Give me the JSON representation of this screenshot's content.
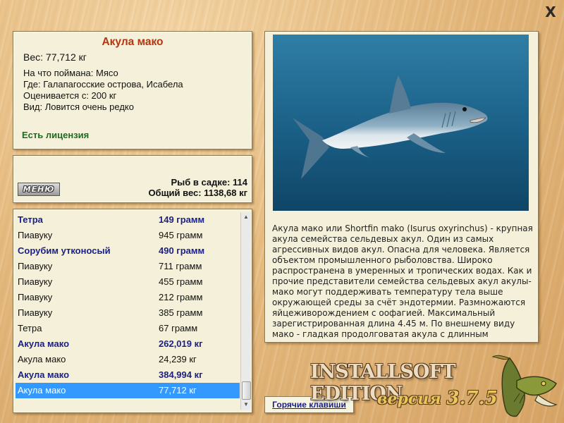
{
  "window": {
    "close_glyph": "X"
  },
  "fish_info": {
    "title": "Акула мако",
    "weight": "Вес: 77,712 кг",
    "bait": "На что поймана: Мясо",
    "location": "Где: Галапагосские острова, Исабела",
    "valued_from": "Оценивается с: 200 кг",
    "rarity": "Вид: Ловится очень редко",
    "license": "Есть лицензия"
  },
  "summary": {
    "menu_logo": "МЕНЮ",
    "fish_count": "Рыб в садке: 114",
    "total_weight": "Общий вес: 1138,68 кг"
  },
  "catch_list": [
    {
      "name": "Тетра",
      "weight": "149 грамм",
      "bold": true,
      "selected": false
    },
    {
      "name": "Пиавуку",
      "weight": "945 грамм",
      "bold": false,
      "selected": false
    },
    {
      "name": "Сорубим утконосый",
      "weight": "490 грамм",
      "bold": true,
      "selected": false
    },
    {
      "name": "Пиавуку",
      "weight": "711 грамм",
      "bold": false,
      "selected": false
    },
    {
      "name": "Пиавуку",
      "weight": "455 грамм",
      "bold": false,
      "selected": false
    },
    {
      "name": "Пиавуку",
      "weight": "212 грамм",
      "bold": false,
      "selected": false
    },
    {
      "name": "Пиавуку",
      "weight": "385 грамм",
      "bold": false,
      "selected": false
    },
    {
      "name": "Тетра",
      "weight": "67 грамм",
      "bold": false,
      "selected": false
    },
    {
      "name": "Акула мако",
      "weight": "262,019 кг",
      "bold": true,
      "selected": false
    },
    {
      "name": "Акула мако",
      "weight": "24,239 кг",
      "bold": false,
      "selected": false
    },
    {
      "name": "Акула мако",
      "weight": "384,994 кг",
      "bold": true,
      "selected": false
    },
    {
      "name": "Акула мако",
      "weight": "77,712 кг",
      "bold": false,
      "selected": true
    }
  ],
  "description": "Акула мако или Shortfin mako (Isurus oxyrinchus) - крупная акула семейства сельдевых акул. Один из самых агрессивных видов акул. Опасна для человека. Является объектом промышленного рыболовства. Широко распространена в умеренных и тропических водах. Как и прочие представители семейства сельдевых акул акулы-мако могут поддерживать температуру тела выше окружающей среды за счёт эндотермии. Размножаются яйцеживорождением с оофагией. Максимальный зарегистрированная длина 4.45 м. По внешнему виду мако - гладкая продолговатая акула с длинным коническим рылом.",
  "footer": {
    "hotkeys_label": "Горячие клавиши",
    "edition": "INSTALLSOFT EDITION",
    "version_label": "версия",
    "version_number": "3.7.5"
  },
  "icons": {
    "close": "close-icon",
    "logo": "pike-fish-logo",
    "scroll_up": "scroll-up-icon",
    "scroll_down": "scroll-down-icon"
  },
  "colors": {
    "title": "#b5360f",
    "license": "#1f6b1f",
    "bold_row": "#1b1e86",
    "selection": "#3399ff",
    "panel_bg": "#f4f0d9"
  }
}
